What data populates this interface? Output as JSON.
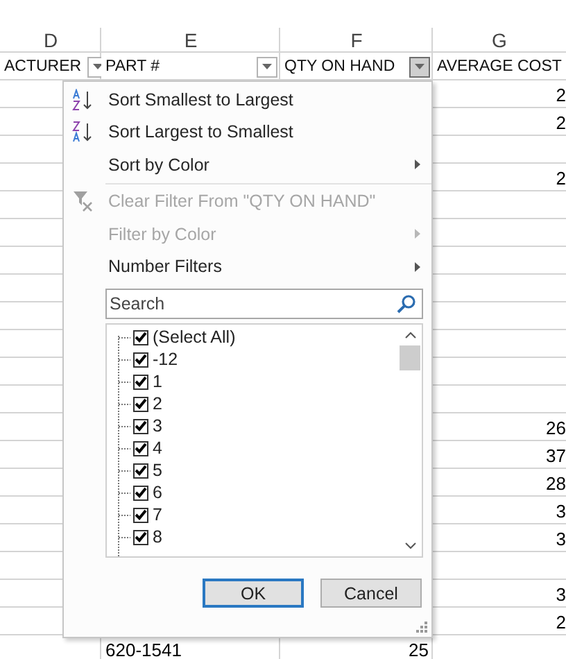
{
  "columns": [
    {
      "letter": "D",
      "header": "ACTURER",
      "filter_open": false
    },
    {
      "letter": "E",
      "header": "PART #",
      "filter_open": false
    },
    {
      "letter": "F",
      "header": "QTY ON HAND",
      "filter_open": true
    },
    {
      "letter": "G",
      "header": "AVERAGE COST"
    }
  ],
  "rows": [
    {
      "g": "2"
    },
    {
      "g": "2"
    },
    {},
    {
      "g": "2"
    },
    {},
    {},
    {},
    {},
    {},
    {},
    {},
    {},
    {
      "g": "26"
    },
    {
      "g": "37"
    },
    {
      "g": "28"
    },
    {
      "g": "3"
    },
    {
      "g": "3"
    },
    {},
    {
      "g": "3"
    },
    {
      "g": "2"
    },
    {
      "e": "620-1541",
      "f": "25"
    }
  ],
  "filter_menu": {
    "items": [
      {
        "kind": "ascending",
        "label": "Sort Smallest to Largest",
        "disabled": false,
        "submenu": false
      },
      {
        "kind": "descending",
        "label": "Sort Largest to Smallest",
        "disabled": false,
        "submenu": false
      },
      {
        "kind": "command",
        "label": "Sort by Color",
        "disabled": false,
        "submenu": true
      },
      {
        "kind": "separator"
      },
      {
        "kind": "clear",
        "label": "Clear Filter From \"QTY ON HAND\"",
        "disabled": true,
        "submenu": false
      },
      {
        "kind": "command",
        "label": "Filter by Color",
        "disabled": true,
        "submenu": true
      },
      {
        "kind": "command",
        "label": "Number Filters",
        "disabled": false,
        "submenu": true
      }
    ],
    "search": {
      "placeholder": "Search"
    },
    "values": [
      {
        "label": "(Select All)",
        "checked": true
      },
      {
        "label": "-12",
        "checked": true
      },
      {
        "label": "1",
        "checked": true
      },
      {
        "label": "2",
        "checked": true
      },
      {
        "label": "3",
        "checked": true
      },
      {
        "label": "4",
        "checked": true
      },
      {
        "label": "5",
        "checked": true
      },
      {
        "label": "6",
        "checked": true
      },
      {
        "label": "7",
        "checked": true
      },
      {
        "label": "8",
        "checked": true
      }
    ],
    "buttons": [
      {
        "label": "OK",
        "default": true
      },
      {
        "label": "Cancel",
        "default": false
      }
    ]
  }
}
